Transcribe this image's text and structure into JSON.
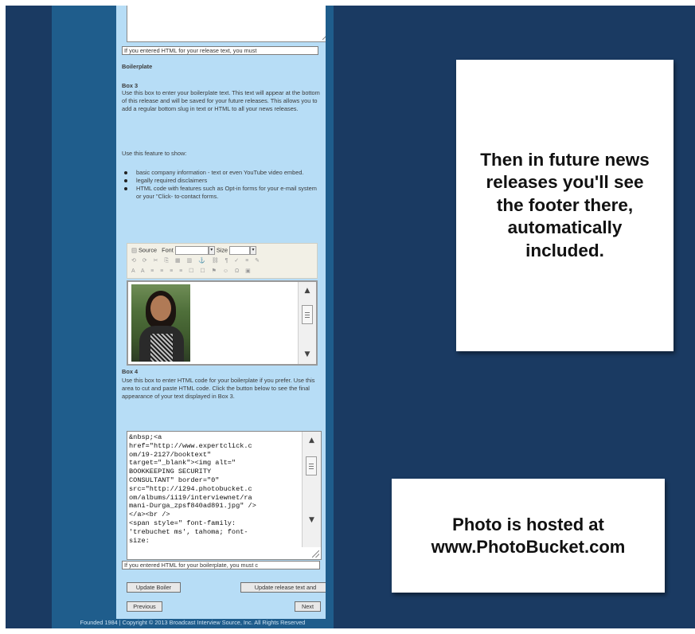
{
  "panel": {
    "release_note": "If you entered HTML for your release text, you must",
    "boilerplate_heading": "Boilerplate",
    "box3_heading": "Box 3",
    "box3_desc": "Use this box to enter your boilerplate text. This text will appear at the bottom of this release and will be saved for your future releases. This allows you to add a regular bottom slug in text or HTML to all your news releases.",
    "feature_intro": "Use this feature to show:",
    "feature_items": [
      "basic company information - text or even YouTube video embed.",
      "legally required disclaimers",
      "HTML code with features such as Opt-in forms for your e-mail system or your \"Click- to-contact forms."
    ],
    "toolbar": {
      "source_label": "Source",
      "font_label": "Font",
      "size_label": "Size"
    },
    "box4_heading": "Box 4",
    "box4_desc": "Use this box to enter HTML code for your boilerplate if you prefer. Use this area to cut and paste HTML code. Click the button below to see the final appearance of your text displayed in Box 3.",
    "code_text": "&nbsp;<a\nhref=\"http://www.expertclick.c\nom/19-2127/booktext\"\ntarget=\"_blank\"><img alt=\"\nBOOKKEEPING SECURITY\nCONSULTANT\" border=\"0\"\nsrc=\"http://i294.photobucket.c\nom/albums/ii19/interviewnet/ra\nmani-Durga_zpsf840ad891.jpg\" />\n</a><br />\n<span style=\" font-family:\n'trebuchet ms', tahoma; font-\nsize:",
    "boiler_note": "If you entered HTML for your boilerplate, you must c",
    "update_boiler_label": "Update Boiler",
    "update_release_label": "Update release text and",
    "previous_label": "Previous",
    "next_label": "Next"
  },
  "footer": {
    "text": "Founded 1984 | Copyright © 2013 Broadcast Interview Source, Inc. All Rights Reserved"
  },
  "callouts": {
    "footer_note": "Then in future news releases you'll see the footer there, automatically included.",
    "photo_note_line1": "Photo is hosted at",
    "photo_note_line2": "www.PhotoBucket.com"
  },
  "colors": {
    "background": "#1a3a62",
    "sidebar": "#1f5d8c",
    "form_panel": "#b7ddf6",
    "callout_card": "#ffffff"
  }
}
